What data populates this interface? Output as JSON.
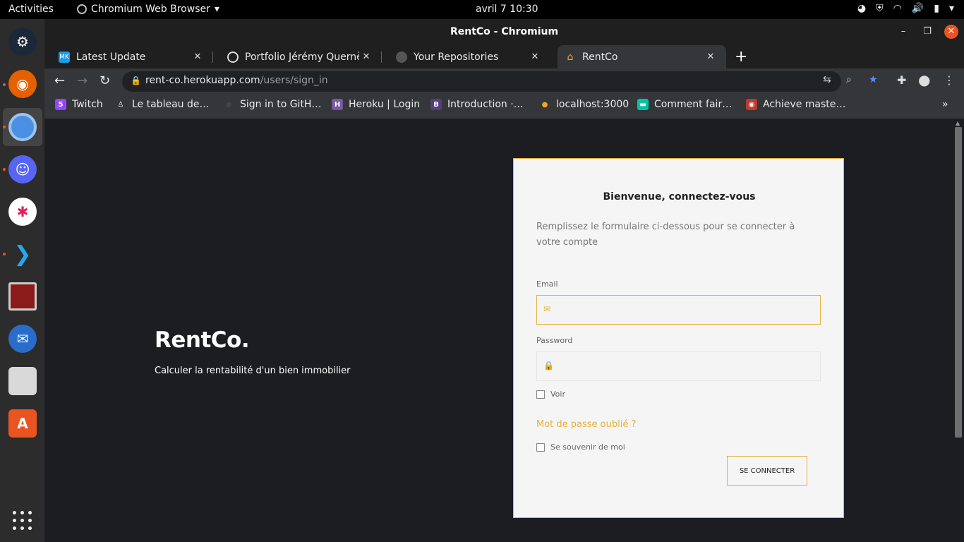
{
  "topbar": {
    "activities": "Activities",
    "app_menu": "Chromium Web Browser",
    "clock": "avril 7  10:30"
  },
  "dock": {
    "apps": [
      "steam-icon",
      "firefox-icon",
      "chromium-icon",
      "discord-icon",
      "slack-icon",
      "vscode-icon",
      "terminal-icon",
      "thunderbird-icon",
      "files-icon",
      "software-icon"
    ]
  },
  "window": {
    "title": "RentCo - Chromium"
  },
  "tabs": [
    {
      "label": "Latest Update",
      "favicon": "MK",
      "color": "#1a9be6"
    },
    {
      "label": "Portfolio Jérémy Quernè",
      "favicon": "globe-icon",
      "color": "#35363a"
    },
    {
      "label": "Your Repositories",
      "favicon": "github-icon",
      "color": "#35363a"
    },
    {
      "label": "RentCo",
      "favicon": "home-icon",
      "color": "#e3b23c"
    }
  ],
  "omnibox": {
    "host": "rent-co.herokuapp.com",
    "path": "/users/sign_in"
  },
  "bookmarks": [
    {
      "label": "Twitch",
      "color": "#9146ff",
      "glyph": "5"
    },
    {
      "label": "Le tableau de…",
      "color": "#35363a",
      "glyph": "♙"
    },
    {
      "label": "Sign in to GitH…",
      "color": "#35363a",
      "glyph": "●"
    },
    {
      "label": "Heroku | Login",
      "color": "#79589f",
      "glyph": "H"
    },
    {
      "label": "Introduction ·…",
      "color": "#563d7c",
      "glyph": "B"
    },
    {
      "label": "localhost:3000",
      "color": "#35363a",
      "glyph": "●"
    },
    {
      "label": "Comment fair…",
      "color": "#00c4a7",
      "glyph": "▬"
    },
    {
      "label": "Achieve maste…",
      "color": "#c0392b",
      "glyph": "◉"
    }
  ],
  "page": {
    "brand": "RentCo.",
    "tagline": "Calculer la rentabilité d'un bien immobilier",
    "form": {
      "heading": "Bienvenue, connectez-vous",
      "description": "Remplissez le formulaire ci-dessous pour se connecter à votre compte",
      "email_label": "Email",
      "password_label": "Password",
      "show_label": "Voir",
      "forgot": "Mot de passe oublié ?",
      "remember": "Se souvenir de moi",
      "submit": "SE CONNECTER"
    }
  }
}
